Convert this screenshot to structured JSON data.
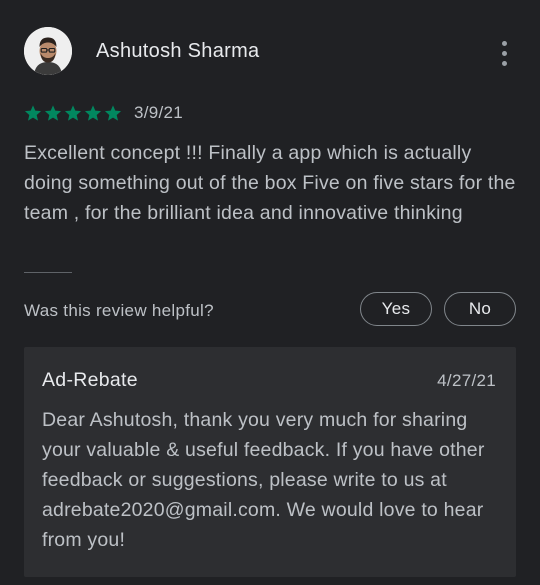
{
  "review": {
    "author_name": "Ashutosh Sharma",
    "avatar_icon": "user-avatar-photo",
    "more_icon": "more-vertical-icon",
    "rating": 5,
    "max_rating": 5,
    "star_color": "#01875f",
    "date": "3/9/21",
    "text": "Excellent concept !!! Finally a app which is actually doing something out of the box Five on five stars for the team , for the brilliant idea and innovative thinking"
  },
  "helpful": {
    "question": "Was this review helpful?",
    "yes_label": "Yes",
    "no_label": "No"
  },
  "developer_reply": {
    "name": "Ad-Rebate",
    "date": "4/27/21",
    "text": "Dear Ashutosh, thank you very much for sharing your valuable & useful feedback. If you have other feedback or suggestions, please write to us at adrebate2020@gmail.com. We would love to hear from you!"
  },
  "colors": {
    "background": "#202124",
    "reply_background": "#2d2e31",
    "primary_text": "#e8eaed",
    "secondary_text": "#bdc1c6",
    "button_border": "#80868b"
  }
}
